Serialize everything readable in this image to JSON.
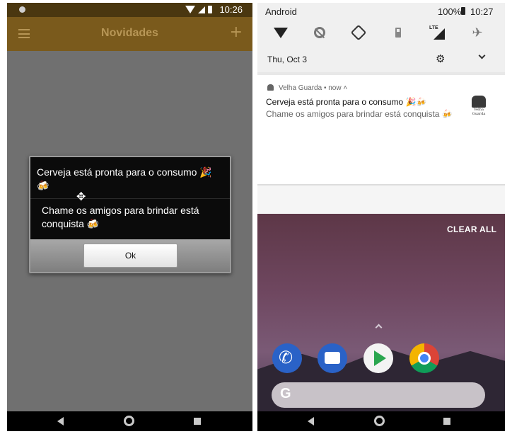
{
  "left_screen": {
    "status_bar": {
      "time": "10:26"
    },
    "app_bar": {
      "title": "Novidades",
      "menu_icon": "hamburger-menu-icon",
      "add_icon": "plus-icon"
    },
    "dialog": {
      "title": "Cerveja está pronta para o consumo 🎉🍻",
      "message": "Chame os amigos para brindar está conquista 🍻",
      "ok_label": "Ok"
    },
    "nav_bar": {
      "back_icon": "back-icon",
      "home_icon": "home-icon",
      "recents_icon": "recents-icon"
    }
  },
  "right_screen": {
    "status_bar": {
      "carrier": "Android",
      "battery": "100%",
      "time": "10:27"
    },
    "quick_settings": {
      "icons": [
        "wifi-icon",
        "dnd-icon",
        "auto-rotate-icon",
        "battery-saver-icon",
        "lte-signal-icon",
        "airplane-mode-icon"
      ],
      "lte_label": "LTE"
    },
    "date": "Thu, Oct 3",
    "notification": {
      "app_name": "Velha Guarda",
      "when": "now",
      "title": "Cerveja está pronta para o consumo 🎉🍻",
      "text": "Chame os amigos para brindar está conquista 🍻",
      "logo_text": "Velha Guarda"
    },
    "clear_all_label": "CLEAR ALL",
    "search_logo": "G",
    "dock": [
      "phone-icon",
      "messages-icon",
      "play-store-icon",
      "chrome-icon"
    ]
  },
  "colors": {
    "left_app_bar": "#7a5a1c",
    "dialog_bg": "#0b0b0b",
    "shade_bg": "#f0f0f0",
    "wallpaper_top": "#5d3747"
  }
}
